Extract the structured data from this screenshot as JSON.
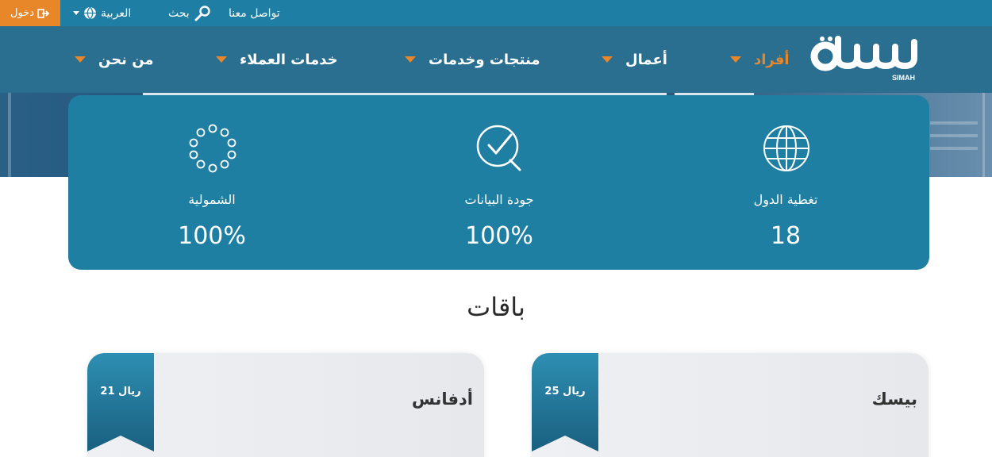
{
  "topbar": {
    "login": "دخول",
    "language": "العربية",
    "search": "بحث",
    "contact": "تواصل معنا"
  },
  "nav": {
    "items": [
      {
        "label": "أفراد",
        "active": true
      },
      {
        "label": "أعمال"
      },
      {
        "label": "منتجات وخدمات"
      },
      {
        "label": "خدمات العملاء"
      },
      {
        "label": "من نحن"
      }
    ],
    "logo_sub": "SIMAH"
  },
  "stats": [
    {
      "icon": "globe-icon",
      "label": "تغطية الدول",
      "value": "18"
    },
    {
      "icon": "search-check-icon",
      "label": "جودة البيانات",
      "value": "100%"
    },
    {
      "icon": "dots-circle-icon",
      "label": "الشمولية",
      "value": "100%"
    }
  ],
  "packages": {
    "title": "باقات",
    "items": [
      {
        "name": "بيسك",
        "price": "25 ريال"
      },
      {
        "name": "أدفانس",
        "price": "21 ريال"
      }
    ]
  },
  "colors": {
    "topbar": "#1e7ea3",
    "nav": "#2b6f90",
    "accent": "#e8862a",
    "stats_bg": "#1e7fa3"
  }
}
